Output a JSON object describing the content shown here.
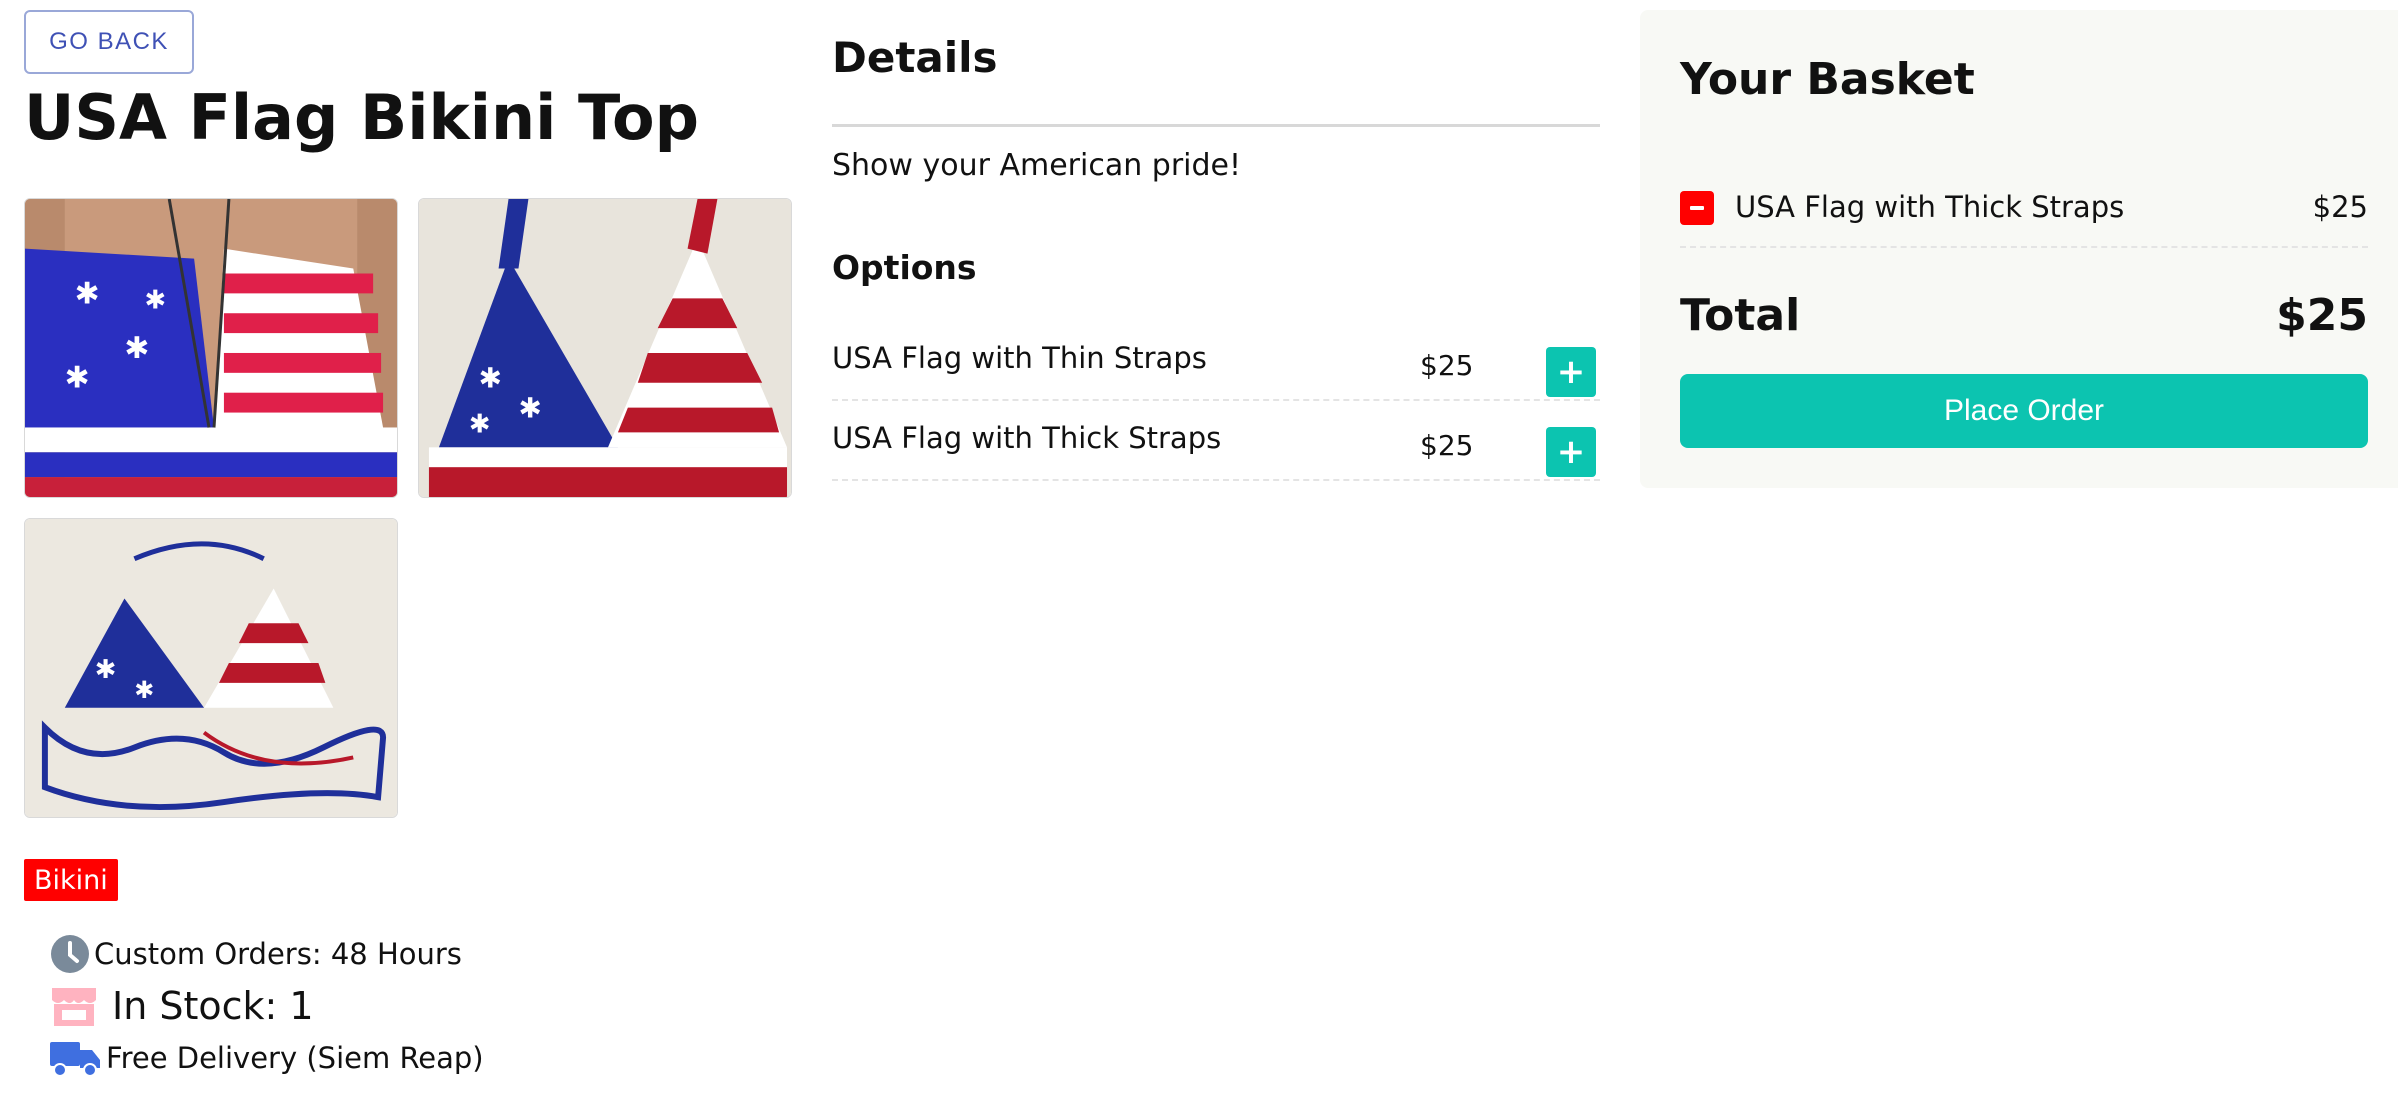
{
  "nav": {
    "back_label": "GO BACK"
  },
  "product": {
    "title": "USA Flag Bikini Top",
    "category": "Bikini",
    "images": [
      {
        "icon": "product-photo-worn"
      },
      {
        "icon": "product-photo-flat"
      },
      {
        "icon": "product-photo-halter"
      }
    ],
    "info": {
      "custom_orders": "Custom Orders: 48 Hours",
      "stock": "In Stock: 1",
      "delivery": "Free Delivery (Siem Reap)"
    }
  },
  "details": {
    "heading": "Details",
    "description": "Show your American pride!",
    "options_heading": "Options",
    "options": [
      {
        "name": "USA Flag with Thin Straps",
        "price": "$25",
        "add_label": "+"
      },
      {
        "name": "USA Flag with Thick Straps",
        "price": "$25",
        "add_label": "+"
      }
    ]
  },
  "basket": {
    "heading": "Your Basket",
    "items": [
      {
        "name": "USA Flag with Thick Straps",
        "price": "$25"
      }
    ],
    "total_label": "Total",
    "total_value": "$25",
    "place_order_label": "Place Order"
  },
  "colors": {
    "accent": "#0cc4b0",
    "danger": "#ff0000",
    "link": "#3f51b5",
    "basket_bg": "#f8f9f5",
    "clock_icon": "#7a8a9a",
    "store_icon": "#ffb3c0",
    "truck_icon": "#3f6fe0"
  }
}
